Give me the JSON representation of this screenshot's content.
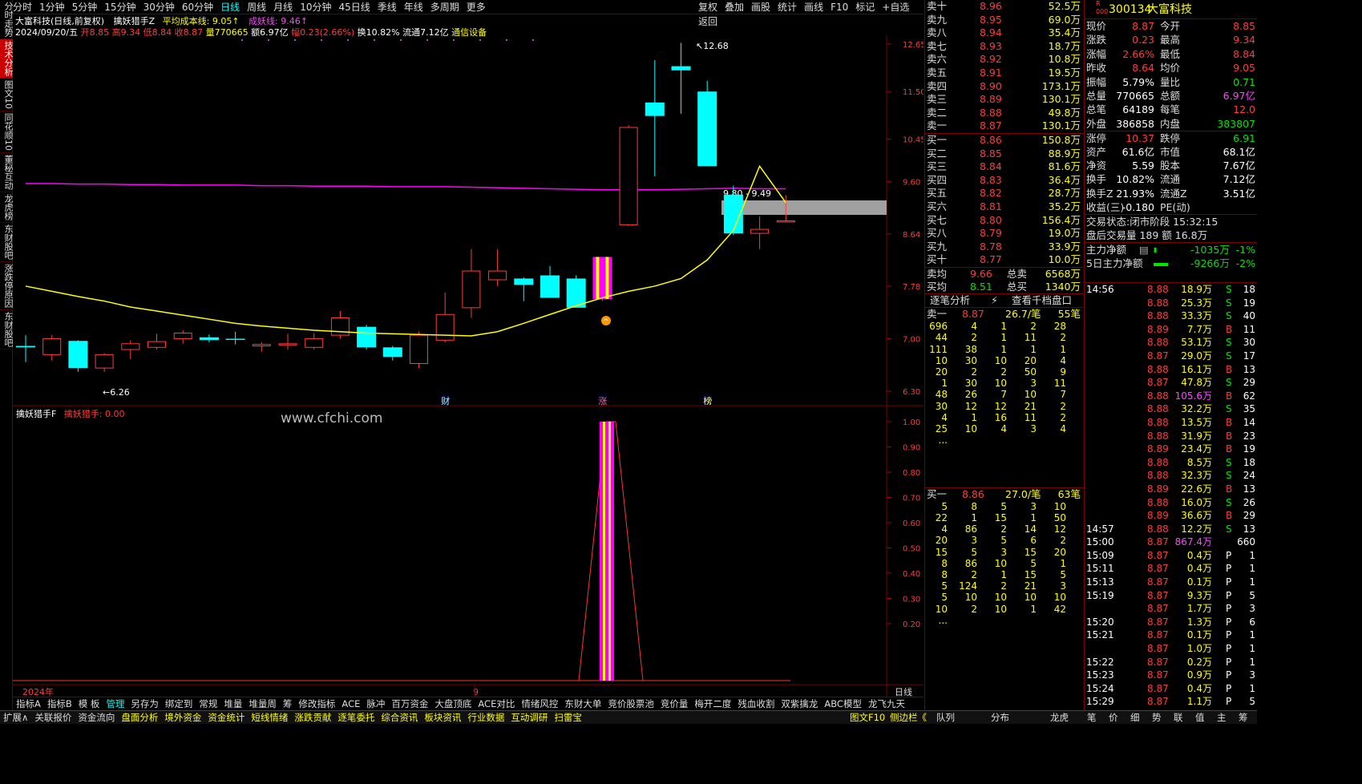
{
  "left_tabs": [
    "分时走势",
    "技术分析",
    "图文10",
    "同花顺10",
    "董秘互动",
    "龙虎榜",
    "东财股吧",
    "涨跌停原因",
    "东财股吧"
  ],
  "periods": [
    "分时",
    "1分钟",
    "5分钟",
    "15分钟",
    "30分钟",
    "60分钟",
    "日线",
    "周线",
    "月线",
    "10分钟",
    "45日线",
    "季线",
    "年线",
    "多周期",
    "更多"
  ],
  "tools": [
    "复权",
    "叠加",
    "画股",
    "统计",
    "画线",
    "F10",
    "标记",
    "+自选",
    "返回"
  ],
  "chart": {
    "title": "大富科技(日线,前复权)",
    "indicator": "擒妖猎手Z",
    "avg_cost": "平均成本线: 9.05↑",
    "yao_line": "成妖线: 9.46↑",
    "date": "2024/09/20/五",
    "open": "开8.85",
    "high": "高9.34",
    "low": "低8.84",
    "close": "收8.87",
    "vol": "量770665",
    "amt": "额6.97亿",
    "chg": "幅0.23(2.66%)",
    "turn": "换10.82%",
    "float": "流通7.12亿",
    "sector": "通信设备",
    "y_ticks": [
      "12.65",
      "11.50",
      "10.45",
      "9.60",
      "8.64",
      "7.78",
      "7.00",
      "6.30"
    ],
    "hi_label": "12.68",
    "lo_label": "6.26",
    "box_label": "9.80 - 9.49",
    "markers": [
      "财",
      "涨",
      "榜"
    ],
    "candles": [
      {
        "o": 6.9,
        "h": 7.05,
        "l": 6.68,
        "c": 6.88
      },
      {
        "o": 6.78,
        "h": 7.05,
        "l": 6.7,
        "c": 7.0
      },
      {
        "o": 6.97,
        "h": 6.98,
        "l": 6.55,
        "c": 6.6
      },
      {
        "o": 6.6,
        "h": 6.8,
        "l": 6.55,
        "c": 6.78
      },
      {
        "o": 6.85,
        "h": 6.98,
        "l": 6.72,
        "c": 6.93
      },
      {
        "o": 6.88,
        "h": 7.07,
        "l": 6.85,
        "c": 6.96
      },
      {
        "o": 7.0,
        "h": 7.12,
        "l": 6.93,
        "c": 7.08
      },
      {
        "o": 7.02,
        "h": 7.06,
        "l": 6.95,
        "c": 6.98
      },
      {
        "o": 7.0,
        "h": 7.1,
        "l": 6.92,
        "c": 6.99
      },
      {
        "o": 6.9,
        "h": 6.95,
        "l": 6.82,
        "c": 6.92
      },
      {
        "o": 6.92,
        "h": 7.07,
        "l": 6.85,
        "c": 6.93
      },
      {
        "o": 6.88,
        "h": 7.08,
        "l": 6.85,
        "c": 7.0
      },
      {
        "o": 7.05,
        "h": 7.4,
        "l": 7.0,
        "c": 7.3
      },
      {
        "o": 7.17,
        "h": 7.2,
        "l": 6.85,
        "c": 6.88
      },
      {
        "o": 6.88,
        "h": 6.9,
        "l": 6.7,
        "c": 6.75
      },
      {
        "o": 6.66,
        "h": 7.1,
        "l": 6.6,
        "c": 7.05
      },
      {
        "o": 6.98,
        "h": 7.68,
        "l": 6.95,
        "c": 7.35
      },
      {
        "o": 7.45,
        "h": 8.38,
        "l": 7.3,
        "c": 8.02
      },
      {
        "o": 7.88,
        "h": 8.38,
        "l": 7.78,
        "c": 8.02
      },
      {
        "o": 7.9,
        "h": 7.92,
        "l": 7.55,
        "c": 7.8
      },
      {
        "o": 7.95,
        "h": 8.1,
        "l": 7.6,
        "c": 7.6
      },
      {
        "o": 7.9,
        "h": 7.95,
        "l": 7.45,
        "c": 7.45
      },
      {
        "o": 7.58,
        "h": 8.25,
        "l": 7.55,
        "c": 8.25
      },
      {
        "o": 8.8,
        "h": 10.75,
        "l": 8.78,
        "c": 10.7
      },
      {
        "o": 11.25,
        "h": 12.25,
        "l": 9.7,
        "c": 10.95
      },
      {
        "o": 12.1,
        "h": 12.68,
        "l": 11.0,
        "c": 12.0
      },
      {
        "o": 11.5,
        "h": 11.75,
        "l": 9.9,
        "c": 9.9
      },
      {
        "o": 9.35,
        "h": 9.52,
        "l": 8.62,
        "c": 8.65
      },
      {
        "o": 8.65,
        "h": 8.95,
        "l": 8.38,
        "c": 8.72
      },
      {
        "o": 8.85,
        "h": 9.34,
        "l": 8.84,
        "c": 8.87
      }
    ],
    "avg_series": [
      7.78,
      7.7,
      7.62,
      7.55,
      7.46,
      7.4,
      7.34,
      7.28,
      7.22,
      7.18,
      7.15,
      7.12,
      7.1,
      7.08,
      7.07,
      7.06,
      7.05,
      7.04,
      7.1,
      7.22,
      7.35,
      7.48,
      7.6,
      7.7,
      7.78,
      7.9,
      8.2,
      8.7,
      9.9,
      9.2,
      9.05,
      9.05
    ],
    "yao_series": [
      9.56,
      9.56,
      9.55,
      9.55,
      9.54,
      9.54,
      9.53,
      9.53,
      9.53,
      9.52,
      9.52,
      9.51,
      9.51,
      9.51,
      9.5,
      9.5,
      9.5,
      9.49,
      9.48,
      9.47,
      9.46,
      9.45,
      9.44,
      9.44,
      9.44,
      9.45,
      9.46,
      9.47,
      9.46,
      9.46,
      9.46
    ]
  },
  "sub": {
    "title": "擒妖猎手F",
    "value_label": "擒妖猎手: 0.00",
    "watermark": "www.cfchi.com",
    "y_ticks": [
      "1.00",
      "0.90",
      "0.80",
      "0.70",
      "0.60",
      "0.50",
      "0.40",
      "0.30",
      "0.20"
    ],
    "x_labels": [
      "2024年",
      "9"
    ],
    "period_label": "日线"
  },
  "bottom_tabs": [
    "指标A",
    "指标B",
    "模 板",
    "管理",
    "另存为",
    "绑定到",
    "常规",
    "堆量",
    "堆量周",
    "筹",
    "修改指标",
    "ACE",
    "脉冲",
    "百万资金",
    "大盘顶底",
    "ACE对比",
    "情绪风控",
    "东财大单",
    "竞价股票池",
    "竞价量",
    "梅开二度",
    "残血收割",
    "双紫擒龙",
    "ABC模型",
    "龙飞九天"
  ],
  "status_left": [
    "扩展∧",
    "关联报价",
    "资金流向",
    "盘面分析",
    "境外资金",
    "资金统计",
    "短线情绪",
    "涨跌贡献",
    "逐笔委托",
    "综合资讯",
    "板块资讯",
    "行业数据",
    "互动调研",
    "扫雷宝"
  ],
  "status_right": [
    "图文F10",
    "侧边栏《",
    "队列",
    "分布",
    "龙虎",
    "笔",
    "价",
    "细",
    "势",
    "联",
    "值",
    "主",
    "筹"
  ],
  "sells": [
    [
      "卖十",
      "8.96",
      "52.5万"
    ],
    [
      "卖九",
      "8.95",
      "69.0万"
    ],
    [
      "卖八",
      "8.94",
      "35.4万"
    ],
    [
      "卖七",
      "8.93",
      "18.7万"
    ],
    [
      "卖六",
      "8.92",
      "10.8万"
    ],
    [
      "卖五",
      "8.91",
      "19.5万"
    ],
    [
      "卖四",
      "8.90",
      "173.1万"
    ],
    [
      "卖三",
      "8.89",
      "130.1万"
    ],
    [
      "卖二",
      "8.88",
      "49.8万"
    ],
    [
      "卖一",
      "8.87",
      "130.1万"
    ]
  ],
  "buys": [
    [
      "买一",
      "8.86",
      "150.8万"
    ],
    [
      "买二",
      "8.85",
      "88.9万"
    ],
    [
      "买三",
      "8.84",
      "81.6万"
    ],
    [
      "买四",
      "8.83",
      "36.4万"
    ],
    [
      "买五",
      "8.82",
      "28.7万"
    ],
    [
      "买六",
      "8.81",
      "35.2万"
    ],
    [
      "买七",
      "8.80",
      "156.4万"
    ],
    [
      "买八",
      "8.79",
      "19.0万"
    ],
    [
      "买九",
      "8.78",
      "33.9万"
    ],
    [
      "买十",
      "8.77",
      "10.0万"
    ]
  ],
  "avg_sell": {
    "label": "卖均",
    "price": "9.66",
    "tlabel": "总卖",
    "total": "6568万"
  },
  "avg_buy": {
    "label": "买均",
    "price": "8.51",
    "tlabel": "总买",
    "total": "1340万"
  },
  "zhubi": {
    "tab1": "逐笔分析",
    "tab2": "查看千档盘口",
    "sell1": "卖一",
    "sell1p": "8.87",
    "sell1q": "26.7/笔",
    "sell1n": "55笔",
    "buy1": "买一",
    "buy1p": "8.86",
    "buy1q": "27.0/笔",
    "buy1n": "63笔",
    "sell_grid": [
      [
        "696",
        "4",
        "1",
        "2",
        "28"
      ],
      [
        "44",
        "2",
        "1",
        "11",
        "2"
      ],
      [
        "111",
        "38",
        "1",
        "1",
        "1"
      ],
      [
        "10",
        "30",
        "10",
        "20",
        "4"
      ],
      [
        "20",
        "2",
        "2",
        "50",
        "9"
      ],
      [
        "1",
        "30",
        "10",
        "3",
        "11"
      ],
      [
        "48",
        "26",
        "7",
        "10",
        "7"
      ],
      [
        "30",
        "12",
        "12",
        "21",
        "2"
      ],
      [
        "4",
        "1",
        "16",
        "11",
        "2"
      ],
      [
        "25",
        "10",
        "4",
        "3",
        "4"
      ],
      [
        "...",
        "",
        "",
        "",
        ""
      ]
    ],
    "buy_grid": [
      [
        "5",
        "8",
        "5",
        "3",
        "10"
      ],
      [
        "22",
        "1",
        "15",
        "1",
        "50"
      ],
      [
        "4",
        "86",
        "2",
        "14",
        "12"
      ],
      [
        "20",
        "3",
        "5",
        "6",
        "2"
      ],
      [
        "15",
        "5",
        "3",
        "15",
        "20"
      ],
      [
        "8",
        "86",
        "10",
        "5",
        "1"
      ],
      [
        "8",
        "2",
        "1",
        "15",
        "5"
      ],
      [
        "5",
        "124",
        "2",
        "21",
        "3"
      ],
      [
        "5",
        "10",
        "10",
        "10",
        "10"
      ],
      [
        "10",
        "2",
        "10",
        "1",
        "42"
      ],
      [
        "...",
        "",
        "",
        "",
        ""
      ]
    ]
  },
  "stock": {
    "code": "300134",
    "name": "大富科技"
  },
  "quote": [
    [
      "现价",
      "8.87",
      "今开",
      "8.85"
    ],
    [
      "涨跌",
      "0.23",
      "最高",
      "9.34"
    ],
    [
      "涨幅",
      "2.66%",
      "最低",
      "8.84"
    ],
    [
      "昨收",
      "8.64",
      "均价",
      "9.05"
    ],
    [
      "振幅",
      "5.79%",
      "量比",
      "0.71"
    ],
    [
      "总量",
      "770665",
      "总额",
      "6.97亿"
    ],
    [
      "总笔",
      "64189",
      "每笔",
      "12.0"
    ],
    [
      "外盘",
      "386858",
      "内盘",
      "383807"
    ],
    [
      "涨停",
      "10.37",
      "跌停",
      "6.91"
    ],
    [
      "资产",
      "61.6亿",
      "市值",
      "68.1亿"
    ],
    [
      "净资",
      "5.59",
      "股本",
      "7.67亿"
    ],
    [
      "换手",
      "10.82%",
      "流通",
      "7.12亿"
    ],
    [
      "换手Z",
      "21.93%",
      "流通Z",
      "3.51亿"
    ],
    [
      "收益(三)",
      "-0.180",
      "PE(动)",
      ""
    ]
  ],
  "trade_status": "交易状态:闭市阶段 15:32:15",
  "after_hours": "盘后交易量 189 额 16.8万",
  "main_flow": {
    "l1": "主力净额",
    "v1": "-1035万",
    "p1": "-1%",
    "l2": "5日主力净额",
    "v2": "-9266万",
    "p2": "-2%"
  },
  "ticks": [
    [
      "14:56",
      "8.88",
      "18.9万",
      "S",
      "18"
    ],
    [
      "",
      "8.88",
      "25.3万",
      "S",
      "19"
    ],
    [
      "",
      "8.88",
      "33.3万",
      "S",
      "40"
    ],
    [
      "",
      "8.89",
      "7.7万",
      "B",
      "11"
    ],
    [
      "",
      "8.88",
      "53.1万",
      "S",
      "30"
    ],
    [
      "",
      "8.87",
      "29.0万",
      "S",
      "17"
    ],
    [
      "",
      "8.88",
      "16.1万",
      "B",
      "13"
    ],
    [
      "",
      "8.87",
      "47.8万",
      "S",
      "29"
    ],
    [
      "",
      "8.88",
      "105.6万",
      "B",
      "62"
    ],
    [
      "",
      "8.88",
      "32.2万",
      "S",
      "35"
    ],
    [
      "",
      "8.88",
      "13.5万",
      "B",
      "14"
    ],
    [
      "",
      "8.88",
      "31.9万",
      "B",
      "23"
    ],
    [
      "",
      "8.89",
      "23.4万",
      "B",
      "19"
    ],
    [
      "",
      "8.88",
      "8.5万",
      "S",
      "18"
    ],
    [
      "",
      "8.88",
      "32.3万",
      "S",
      "24"
    ],
    [
      "",
      "8.89",
      "22.6万",
      "B",
      "13"
    ],
    [
      "",
      "8.88",
      "16.0万",
      "S",
      "26"
    ],
    [
      "",
      "8.89",
      "36.6万",
      "B",
      "29"
    ],
    [
      "14:57",
      "8.88",
      "12.2万",
      "S",
      "13"
    ],
    [
      "15:00",
      "8.87",
      "867.4万",
      "",
      "660"
    ],
    [
      "15:09",
      "8.87",
      "0.4万",
      "P",
      "1"
    ],
    [
      "15:11",
      "8.87",
      "0.4万",
      "P",
      "1"
    ],
    [
      "15:13",
      "8.87",
      "0.1万",
      "P",
      "1"
    ],
    [
      "15:19",
      "8.87",
      "9.3万",
      "P",
      "5"
    ],
    [
      "",
      "8.87",
      "1.7万",
      "P",
      "3"
    ],
    [
      "15:20",
      "8.87",
      "1.3万",
      "P",
      "6"
    ],
    [
      "15:21",
      "8.87",
      "0.1万",
      "P",
      "1"
    ],
    [
      "",
      "8.87",
      "1.0万",
      "P",
      "1"
    ],
    [
      "15:22",
      "8.87",
      "0.2万",
      "P",
      "1"
    ],
    [
      "15:23",
      "8.87",
      "0.9万",
      "P",
      "3"
    ],
    [
      "15:24",
      "8.87",
      "0.4万",
      "P",
      "1"
    ],
    [
      "15:29",
      "8.87",
      "1.1万",
      "P",
      "5"
    ]
  ]
}
